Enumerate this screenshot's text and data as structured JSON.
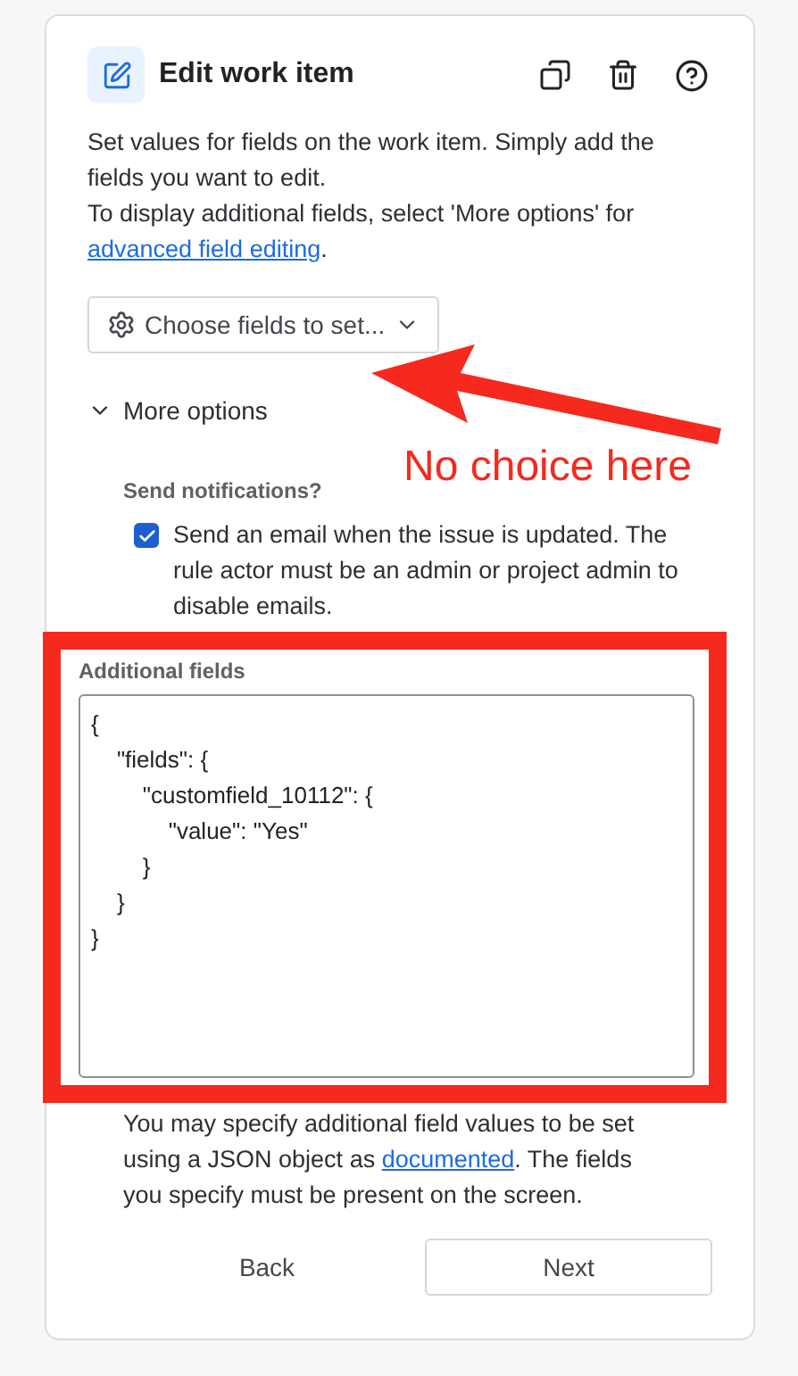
{
  "header": {
    "title": "Edit work item"
  },
  "description": {
    "text": "Set values for fields on the work item. Simply add the fields you want to edit.",
    "text2": "To display additional fields, select 'More options' for",
    "link": "advanced field editing",
    "after": "."
  },
  "choose_button": {
    "label": "Choose fields to set..."
  },
  "more_options": {
    "label": "More options",
    "expanded": true
  },
  "notifications": {
    "label": "Send notifications?",
    "checkbox_label": "Send an email when the issue is updated. The rule actor must be an admin or project admin to disable emails.",
    "checked": true
  },
  "additional_fields": {
    "label": "Additional fields",
    "value": "{\n    \"fields\": {\n        \"customfield_10112\": {\n            \"value\": \"Yes\"\n        }\n    }\n}"
  },
  "help": {
    "before": "You may specify additional field values to be set using a JSON object as",
    "link": "documented",
    "after": ". The fields you specify must be present on the screen."
  },
  "buttons": [
    {
      "label": "Back",
      "kind": "subtle"
    },
    {
      "label": "Next",
      "kind": "outline"
    }
  ],
  "annotation": {
    "text": "No choice here"
  }
}
